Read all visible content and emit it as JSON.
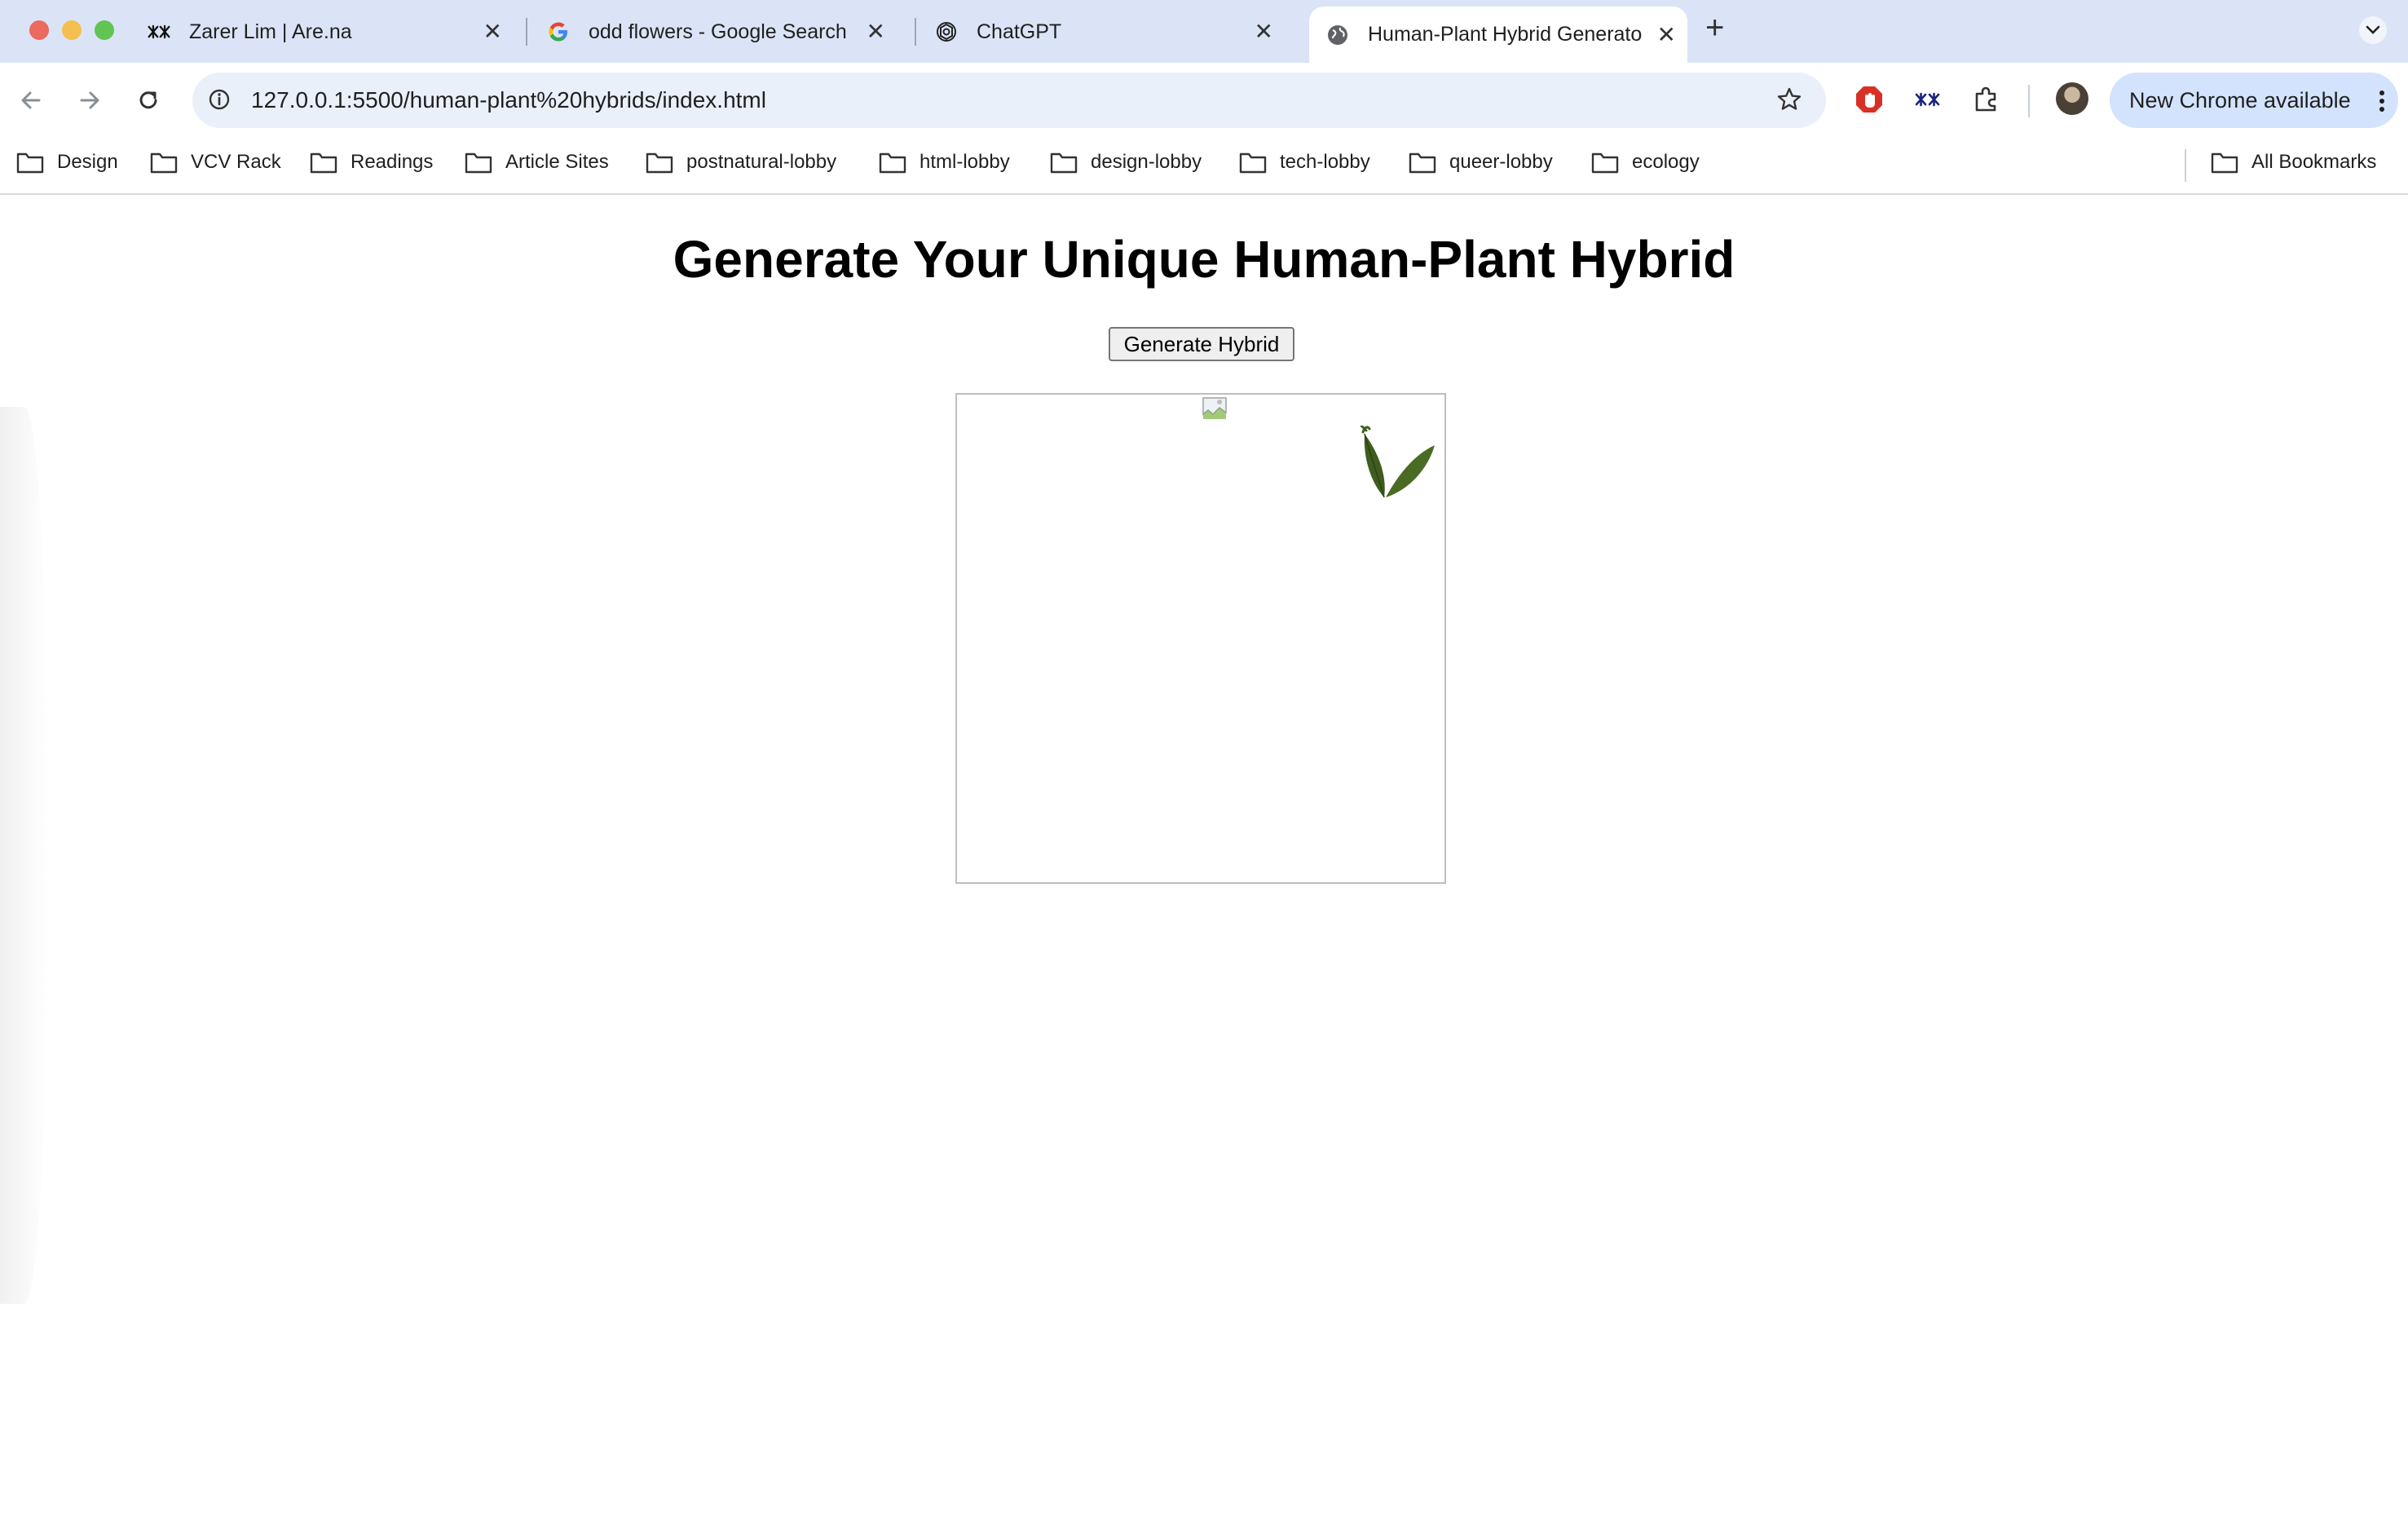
{
  "browser": {
    "tabs": [
      {
        "title": "Zarer Lim | Are.na",
        "icon": "arena-icon",
        "active": false
      },
      {
        "title": "odd flowers - Google Search",
        "icon": "google-icon",
        "active": false
      },
      {
        "title": "ChatGPT",
        "icon": "chatgpt-icon",
        "active": false
      },
      {
        "title": "Human-Plant Hybrid Generato",
        "icon": "globe-icon",
        "active": true
      }
    ],
    "address": "127.0.0.1:5500/human-plant%20hybrids/index.html",
    "update_label": "New Chrome available",
    "bookmarks": [
      "Design",
      "VCV Rack",
      "Readings",
      "Article Sites",
      "postnatural-lobby",
      "html-lobby",
      "design-lobby",
      "tech-lobby",
      "queer-lobby",
      "ecology"
    ],
    "all_bookmarks": "All Bookmarks"
  },
  "page": {
    "title": "Generate Your Unique Human-Plant Hybrid",
    "generate_button": "Generate Hybrid"
  },
  "colors": {
    "tabstrip": "#dbe4f6",
    "omnibox": "#eaf0fa",
    "update_pill": "#d3e3fd",
    "leaf": "#3f5d1e"
  }
}
